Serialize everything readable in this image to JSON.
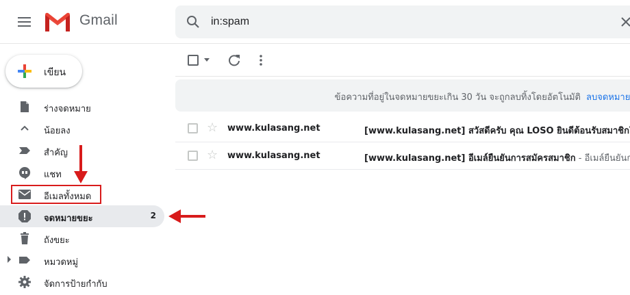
{
  "app": {
    "brand": "Gmail"
  },
  "search": {
    "value": "in:spam"
  },
  "compose": {
    "label": "เขียน"
  },
  "nav": {
    "items": [
      {
        "label": "ร่างจดหมาย",
        "icon": "draft-icon"
      },
      {
        "label": "น้อยลง",
        "icon": "chevron-up-icon"
      },
      {
        "label": "สำคัญ",
        "icon": "important-icon"
      },
      {
        "label": "แชท",
        "icon": "chat-icon"
      },
      {
        "label": "อีเมลทั้งหมด",
        "icon": "mail-icon"
      },
      {
        "label": "จดหมายขยะ",
        "icon": "spam-icon",
        "count": "2",
        "active": true
      },
      {
        "label": "ถังขยะ",
        "icon": "trash-icon"
      },
      {
        "label": "หมวดหมู่",
        "icon": "label-icon"
      },
      {
        "label": "จัดการป้ายกำกับ",
        "icon": "gear-icon"
      }
    ]
  },
  "banner": {
    "text": "ข้อความที่อยู่ในจดหมายขยะเกิน 30 วัน จะถูกลบทิ้งโดยอัตโนมัติ",
    "link": "ลบจดหมายขยะทั้งหมดเลย"
  },
  "emails": [
    {
      "sender": "www.kulasang.net",
      "subject": "[www.kulasang.net] สวัสดีครับ คุณ LOSO ยินดีต้อนรับสมาชิกใหม่",
      "snippet": ""
    },
    {
      "sender": "www.kulasang.net",
      "subject": "[www.kulasang.net] อีเมล์ยืนยันการสมัครสมาชิก",
      "snippet": " - อีเมล์ยืนยันการสมัครสมาชิก"
    }
  ],
  "colors": {
    "annotation_red": "#d81b1b",
    "link_blue": "#1a73e8",
    "active_bg": "#e8eaed"
  }
}
